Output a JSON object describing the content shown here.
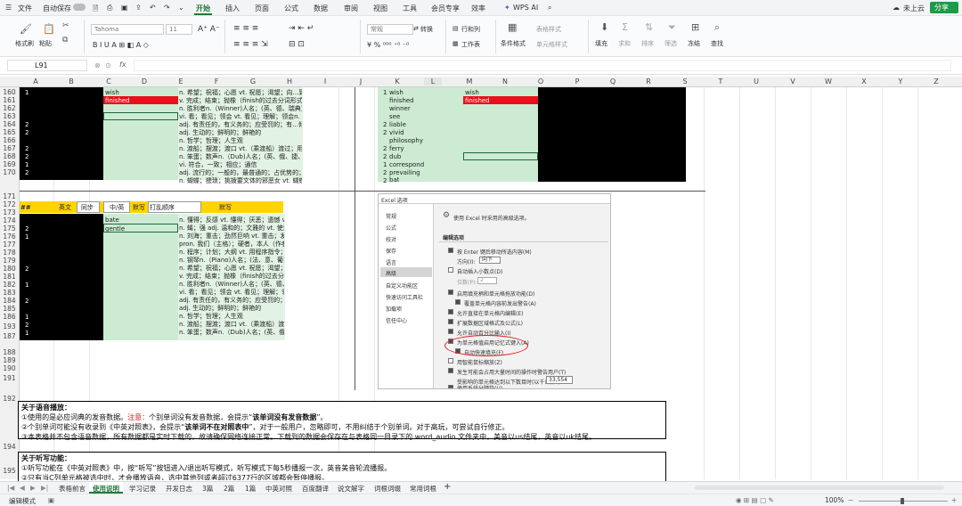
{
  "menubar": {
    "file": "文件",
    "autosave": "自动保存",
    "tabs": [
      "开始",
      "插入",
      "页面",
      "公式",
      "数据",
      "审阅",
      "视图",
      "工具",
      "会员专享",
      "效率"
    ],
    "wps_ai": "WPS AI",
    "cloud": "未上云",
    "share": "分享"
  },
  "ribbon": {
    "format_painter": "格式刷",
    "paste": "粘贴",
    "font": "Tahoma",
    "font_size": "11",
    "number_format": "常规",
    "convert": "转换",
    "row_col": "行和列",
    "worksheet": "工作表",
    "cond_format": "条件格式",
    "table_style": "表格样式",
    "cell_style": "单元格样式",
    "fill": "填充",
    "sum": "求和",
    "sort": "排序",
    "filter": "筛选",
    "freeze": "冻结",
    "find": "查找"
  },
  "formulabar": {
    "cellref": "L91",
    "fx": "fx"
  },
  "columns": [
    "A",
    "B",
    "C",
    "D",
    "E",
    "F",
    "G",
    "H",
    "I",
    "J",
    "K",
    "L",
    "M",
    "N",
    "O",
    "P",
    "Q",
    "R",
    "S",
    "T",
    "U",
    "V",
    "W",
    "X",
    "Y",
    "Z"
  ],
  "rows": [
    "160",
    "161",
    "162",
    "163",
    "164",
    "165",
    "166",
    "167",
    "168",
    "169",
    "170",
    "171",
    "172",
    "173",
    "174",
    "175",
    "176",
    "177",
    "178",
    "179",
    "180",
    "181",
    "182",
    "183",
    "184",
    "185",
    "186",
    "193",
    "187",
    "188",
    "189",
    "190",
    "191",
    "192",
    "194",
    "195"
  ],
  "left_top": {
    "words": [
      "wish",
      "finished"
    ],
    "nums": [
      "1",
      "2",
      "2",
      "2",
      "2",
      "1",
      "2"
    ],
    "defs": [
      "n. 希望；祝福；心愿 vt. 祝愿；渴望；向…致意",
      "v. 完成；结束；抛橡（finish的过去分词形式）",
      "n. 胜利者n.（Winner)人名；(英、德、瑞典)温",
      "vi. 看；看见；领会 vt. 看见；理解；领会n.（S",
      "adj. 有责任的，有义务的；应受罚的；有…倾向",
      "adj. 生动的；鲜明的；鲜艳的",
      "n. 哲学；哲理；人生观",
      "n. 渡船；摆渡；渡口 vt.（乘渡船）渡过；用渡",
      "n. 笨蛋；数声n.（Dub)人名；(英、俄、捷、匈",
      "vi. 符合，一致；相应；通信",
      "adj. 流行的；一般的，最普通的；占优势的；普",
      "n. 蝴蝶；猥琐；挑拨要文体的邪恶女 vt. 蝴蝶"
    ]
  },
  "right_top": {
    "nums": [
      "1",
      "2",
      "2",
      "2",
      "2",
      "1",
      "2",
      "2"
    ],
    "words": [
      "wish",
      "finished",
      "winner",
      "see",
      "liable",
      "vivid",
      "philosophy",
      "ferry",
      "dub",
      "correspond",
      "prevailing",
      "bat"
    ],
    "m_words": [
      "wish",
      "finished"
    ]
  },
  "left_bottom": {
    "headers": [
      "英文",
      "同步",
      "中/英",
      "默写",
      "打乱顺序",
      "默写"
    ],
    "words": [
      "bate",
      "gentle"
    ],
    "nums": [
      "2",
      "1",
      "2",
      "1",
      "2",
      "1",
      "2",
      "1"
    ],
    "defs": [
      "n. 懂得；反感 vt. 懂得；厌恶；遗憾 vi.",
      "n. 蝇；强 adj. 温和的；文雅的 vt. 使温",
      "n. 刘海；重击；劲然巨响 vt. 重击；发出",
      "pron. 我们（主格）；硬者，本人（作者",
      "n. 程序；计划；大纲 vt. 用程序指令；为",
      "n. 钢琴n.（Piano)人名；(法、意、葡)皮",
      "n. 希望；祝福；心愿 vt. 祝愿；渴望；向",
      "v. 完成；结束；抛橡（finish的过去分词",
      "n. 胜利者n.（Winner)人名；(英、德、瑞",
      "vi. 看；看见；领会 vt. 看见；理解；领会",
      "adj. 有责任的，有义务的；应受罚的；有",
      "adj. 生动的；鲜明的；鲜艳的",
      "n. 哲学；哲理；人生观",
      "n. 渡船；摆渡；渡口 vt.（乘渡船）渡过",
      "n. 笨蛋；数声n.（Dub)人名；(英、俄、捷"
    ]
  },
  "dialog": {
    "title": "Excel 选项",
    "nav": [
      "常规",
      "公式",
      "校对",
      "保存",
      "语言",
      "高级",
      "自定义功能区",
      "快速访问工具栏",
      "加载项",
      "信任中心"
    ],
    "header": "使用 Excel 时采用的高级选项。",
    "section": "编辑选项",
    "options": [
      "按 Enter 键后移动所选内容(M)",
      "方向(I):",
      "自动插入小数点(D)",
      "位数(P):",
      "启用填充柄和单元格拖放功能(D)",
      "覆盖单元格内容前发出警告(A)",
      "允许直接在单元格内编辑(E)",
      "扩展数据区域格式及公式(L)",
      "允许自动百分比输入(I)",
      "为单元格值启用记忆式键入(A)",
      "自动快速填充(F)",
      "用智能鼠标缩放(Z)",
      "发生可能会占用大量时间的操作时警告用户(T)",
      "受影响的单元格达到以下数目时(以千计)(U):",
      "使用系统分隔符(U)"
    ],
    "direction_value": "向下",
    "places_value": "2",
    "count_value": "33,554"
  },
  "notes": {
    "voice_title": "关于语音播放：",
    "voice_l1a": "①使用的是必应词典的发音数据。",
    "voice_l1b": "注意：",
    "voice_l1c": "个别单词没有发音数据，会提示“",
    "voice_l1d": "该单词没有发音数据",
    "voice_l1e": "”。",
    "voice_l2a": "②个别单词可能没有收录到《中英对照表》，会提示“",
    "voice_l2b": "该单词不在对照表中",
    "voice_l2c": "”，对于一般用户，忽略即可，不用纠结于个别单词。对于高玩，可尝试自行修正。",
    "voice_l3": "③本表格并不包含语音数据，所有数据都是实时下载的，故请确保网络连接正常。下载到的数据会保存在与表格同一目录下的 word_audio 文件夹中，美音以us结尾，英音以uk结尾。",
    "dict_title": "关于听写功能：",
    "dict_l1": "①听写功能在《中英对照表》中，按“听写”按钮进入/退出听写模式，听写模式下每5秒播报一次，英音美音轮流播报。",
    "dict_l2": "②只有当C列单元格被选中时，才会播放语音，选中其他列或者超过6377行的区域都会暂停播报。"
  },
  "sheet_tabs": [
    "表格前言",
    "使用说明",
    "学习记录",
    "开发日志",
    "3篇",
    "2篇",
    "1篇",
    "中英对照",
    "百度翻译",
    "说文解字",
    "词根词缀",
    "常用词根"
  ],
  "active_sheet": "使用说明",
  "status": {
    "mode": "编辑模式",
    "zoom": "100%"
  }
}
